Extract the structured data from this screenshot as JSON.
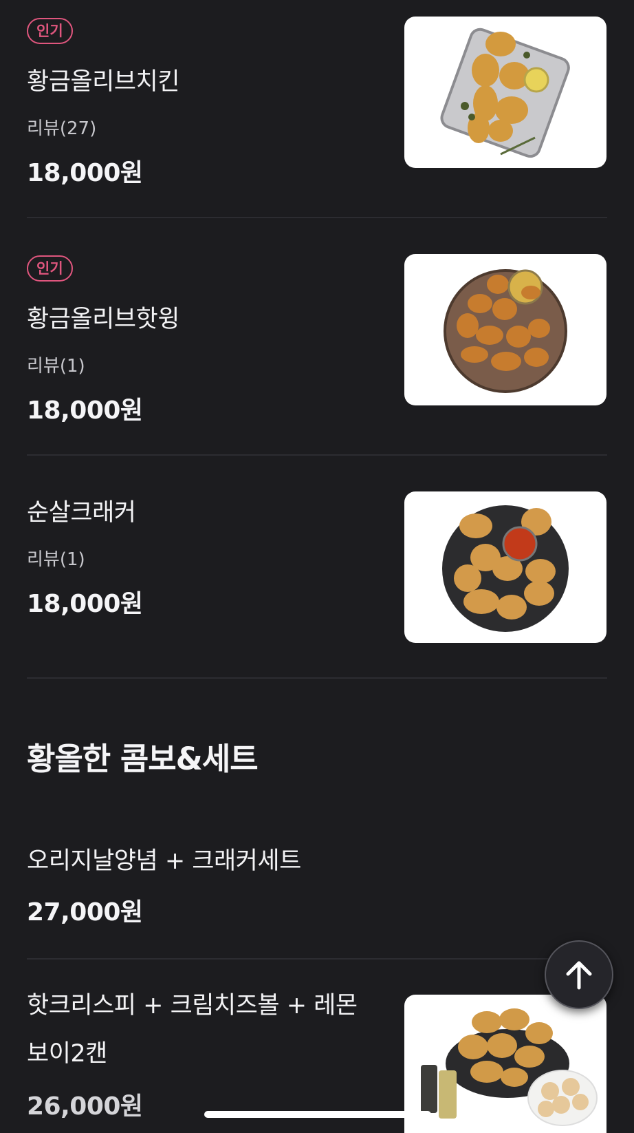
{
  "items": [
    {
      "badge": "인기",
      "name": "황금올리브치킨",
      "review": "리뷰(27)",
      "price": "18,000원",
      "image": "fried-chicken-tray"
    },
    {
      "badge": "인기",
      "name": "황금올리브핫윙",
      "review": "리뷰(1)",
      "price": "18,000원",
      "image": "hot-wings-plate"
    },
    {
      "name": "순살크래커",
      "review": "리뷰(1)",
      "price": "18,000원",
      "image": "boneless-cracker-plate"
    }
  ],
  "section": {
    "title": "황올한 콤보&세트"
  },
  "combo_items": [
    {
      "name": "오리지날양념 + 크래커세트",
      "price": "27,000원"
    },
    {
      "name_line1": "핫크리스피 + 크림치즈볼 + 레몬",
      "name_line2": "보이2캔",
      "price": "26,000원",
      "image": "combo-chicken-cheeseballs-cans"
    }
  ],
  "colors": {
    "background": "#1c1c1f",
    "badge": "#e0567e",
    "divider": "#2c2c31"
  },
  "icons": {
    "scroll_top": "arrow-up-icon"
  }
}
